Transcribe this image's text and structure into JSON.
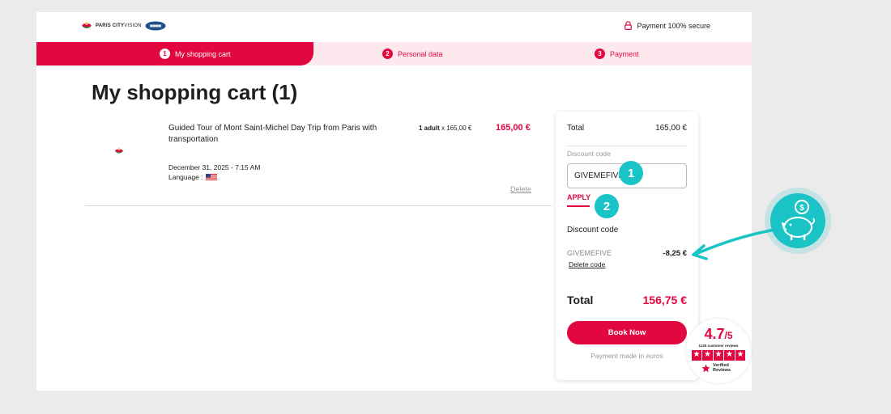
{
  "header": {
    "logo_text_bold": "PARIS CITY",
    "logo_text_thin": "VISION",
    "secure_label": "Payment 100% secure"
  },
  "steps": [
    {
      "num": "1",
      "label": "My shopping cart"
    },
    {
      "num": "2",
      "label": "Personal data"
    },
    {
      "num": "3",
      "label": "Payment"
    }
  ],
  "page_title": "My shopping cart (1)",
  "cart_item": {
    "name": "Guided Tour of Mont Saint-Michel Day Trip from Paris with transportation",
    "qty_bold": "1 adult",
    "qty_rest": " x 165,00 €",
    "price": "165,00 €",
    "date": "December 31, 2025 - 7:15 AM",
    "language_label": "Language :",
    "delete_label": "Delete"
  },
  "summary": {
    "total_label": "Total",
    "total_value": "165,00 €",
    "discount_field_label": "Discount code",
    "discount_input_value": "GIVEMEFIVE",
    "apply_label": "APPLY",
    "discount_section_title": "Discount code",
    "applied_code": "GIVEMEFIVE",
    "discount_amount": "-8,25 €",
    "delete_code_label": "Delete code",
    "grand_total_label": "Total",
    "grand_total_value": "156,75 €",
    "book_label": "Book Now",
    "payment_note": "Payment made in euros"
  },
  "callouts": [
    "1",
    "2"
  ],
  "rating": {
    "score": "4.7",
    "out_of": "/5",
    "count_label": "1130 customer reviews",
    "verified_label": "Verified Reviews"
  },
  "colors": {
    "brand": "#e2073f",
    "brand_light": "#fde8ee",
    "callout": "#19c3c6"
  }
}
